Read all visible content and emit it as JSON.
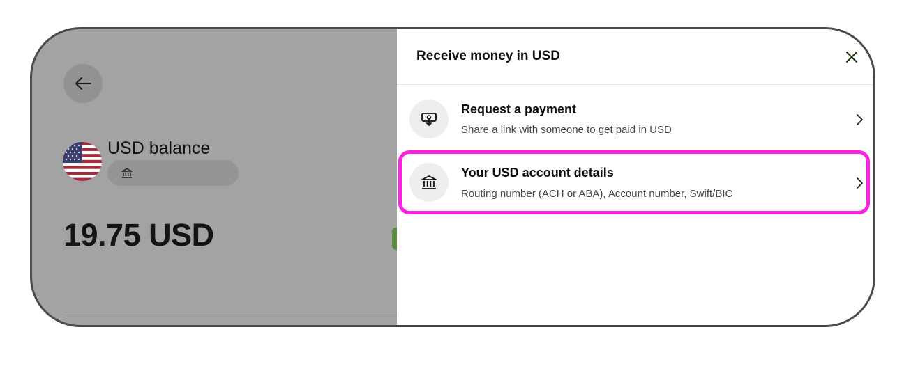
{
  "left_panel": {
    "balance_title": "USD balance",
    "amount": "19.75 USD",
    "icons": {
      "back": "arrow-left-icon",
      "flag": "us-flag-icon",
      "bank": "bank-icon"
    }
  },
  "sheet": {
    "title": "Receive money in USD",
    "close_icon": "close-icon",
    "options": [
      {
        "title": "Request a payment",
        "subtitle": "Share a link with someone to get paid in USD",
        "icon": "request-payment-icon"
      },
      {
        "title": "Your USD account details",
        "subtitle": "Routing number (ACH or ABA), Account number, Swift/BIC",
        "icon": "bank-icon",
        "highlighted": true
      }
    ]
  },
  "colors": {
    "overlay": "#a3a3a3",
    "highlight": "#ff1fe0",
    "text_primary": "#0e0f0c",
    "text_secondary": "#454745",
    "icon_bg": "#eeeeec"
  }
}
